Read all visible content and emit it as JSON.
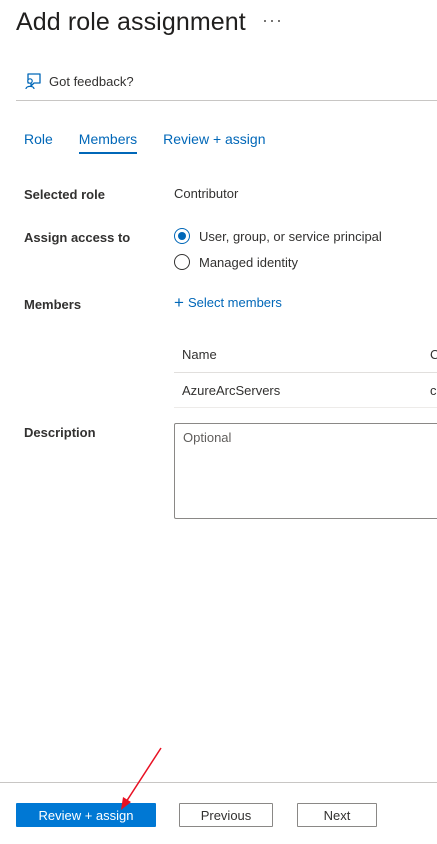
{
  "header": {
    "title": "Add role assignment",
    "more_label": "···"
  },
  "feedback": {
    "label": "Got feedback?"
  },
  "tabs": [
    {
      "label": "Role",
      "active": false
    },
    {
      "label": "Members",
      "active": true
    },
    {
      "label": "Review + assign",
      "active": false
    }
  ],
  "form": {
    "selected_role": {
      "label": "Selected role",
      "value": "Contributor"
    },
    "assign_access": {
      "label": "Assign access to",
      "options": [
        {
          "label": "User, group, or service principal",
          "checked": true
        },
        {
          "label": "Managed identity",
          "checked": false
        }
      ]
    },
    "members": {
      "label": "Members",
      "select_label": "Select members",
      "table": {
        "columns": [
          "Name",
          "C"
        ],
        "rows": [
          {
            "name": "AzureArcServers",
            "second": "c"
          }
        ]
      }
    },
    "description": {
      "label": "Description",
      "placeholder": "Optional"
    }
  },
  "footer": {
    "review_assign_label": "Review + assign",
    "previous_label": "Previous",
    "next_label": "Next"
  },
  "colors": {
    "accent": "#0078d4",
    "link": "#0067b8",
    "annotation_arrow": "#e81123"
  }
}
